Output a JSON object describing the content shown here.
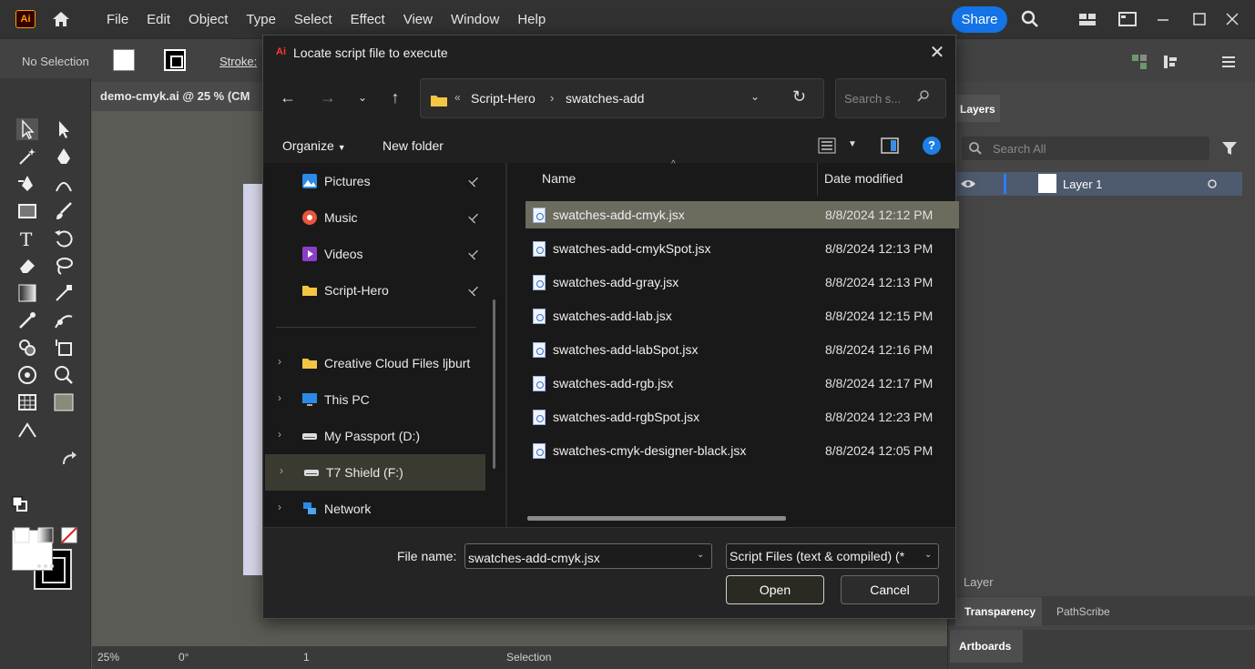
{
  "app": {
    "logo": "Ai",
    "menus": [
      "File",
      "Edit",
      "Object",
      "Type",
      "Select",
      "Effect",
      "View",
      "Window",
      "Help"
    ],
    "share_label": "Share"
  },
  "control_bar": {
    "selection_text": "No Selection",
    "stroke_label": "Stroke:"
  },
  "document": {
    "tab_title": "demo-cmyk.ai @ 25 % (CM"
  },
  "status_bar": {
    "zoom": "25%",
    "rotation": "0°",
    "artboard_number": "1",
    "mode": "Selection"
  },
  "layers_panel": {
    "tab_label": "Layers",
    "search_placeholder": "Search All",
    "layer_name": "Layer 1",
    "footer_label": "Layer"
  },
  "bottom_panels": {
    "transparency_tab": "Transparency",
    "pathscribe_tab": "PathScribe",
    "artboards_tab": "Artboards"
  },
  "dialog": {
    "app_icon": "Ai",
    "title": "Locate script file to execute",
    "address": {
      "prefix": "«",
      "segments": [
        "Script-Hero",
        "swatches-add"
      ],
      "separator": "›"
    },
    "search_placeholder": "Search s...",
    "organize_label": "Organize",
    "new_folder_label": "New folder",
    "help_label": "?",
    "nav_items": [
      {
        "label": "Pictures",
        "icon": "pictures-icon",
        "pinned": true
      },
      {
        "label": "Music",
        "icon": "music-icon",
        "pinned": true
      },
      {
        "label": "Videos",
        "icon": "videos-icon",
        "pinned": true
      },
      {
        "label": "Script-Hero",
        "icon": "folder-icon",
        "pinned": true
      },
      {
        "label": "Creative Cloud Files  ljburt",
        "icon": "folder-icon",
        "pinned": false
      },
      {
        "label": "This PC",
        "icon": "pc-icon",
        "pinned": false
      },
      {
        "label": "My Passport (D:)",
        "icon": "drive-icon",
        "pinned": false
      },
      {
        "label": "T7 Shield (F:)",
        "icon": "drive-icon",
        "pinned": false
      },
      {
        "label": "Network",
        "icon": "network-icon",
        "pinned": false
      }
    ],
    "columns": {
      "name": "Name",
      "date": "Date modified"
    },
    "files": [
      {
        "name": "swatches-add-cmyk.jsx",
        "date": "8/8/2024 12:12 PM",
        "selected": true
      },
      {
        "name": "swatches-add-cmykSpot.jsx",
        "date": "8/8/2024 12:13 PM",
        "selected": false
      },
      {
        "name": "swatches-add-gray.jsx",
        "date": "8/8/2024 12:13 PM",
        "selected": false
      },
      {
        "name": "swatches-add-lab.jsx",
        "date": "8/8/2024 12:15 PM",
        "selected": false
      },
      {
        "name": "swatches-add-labSpot.jsx",
        "date": "8/8/2024 12:16 PM",
        "selected": false
      },
      {
        "name": "swatches-add-rgb.jsx",
        "date": "8/8/2024 12:17 PM",
        "selected": false
      },
      {
        "name": "swatches-add-rgbSpot.jsx",
        "date": "8/8/2024 12:23 PM",
        "selected": false
      },
      {
        "name": "swatches-cmyk-designer-black.jsx",
        "date": "8/8/2024 12:05 PM",
        "selected": false
      }
    ],
    "file_name_label": "File name:",
    "file_name_value": "swatches-add-cmyk.jsx",
    "file_type": "Script Files (text & compiled) (*",
    "open_label": "Open",
    "cancel_label": "Cancel"
  },
  "colors": {
    "share_blue": "#1473e6",
    "ai_orange": "#ff9a00",
    "selected_row": "#6b6b5e"
  }
}
